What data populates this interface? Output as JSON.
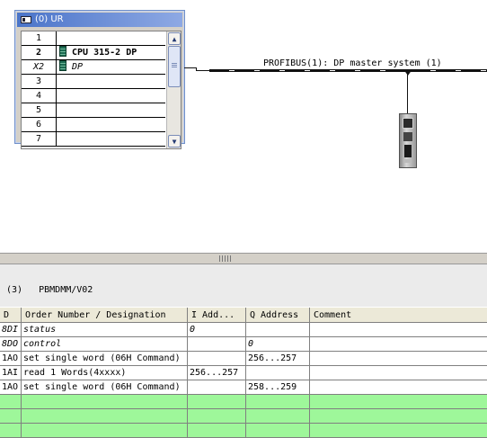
{
  "rack": {
    "title": "(0) UR",
    "slots": [
      {
        "num": "1",
        "module": ""
      },
      {
        "num": "2",
        "module": "CPU 315-2 DP"
      },
      {
        "num": "X2",
        "module": "DP"
      },
      {
        "num": "3",
        "module": ""
      },
      {
        "num": "4",
        "module": ""
      },
      {
        "num": "5",
        "module": ""
      },
      {
        "num": "6",
        "module": ""
      },
      {
        "num": "7",
        "module": ""
      }
    ]
  },
  "bus": {
    "label": "PROFIBUS(1): DP master system (1)"
  },
  "detail": {
    "header": "(3)   PBMDMM/V02",
    "columns": [
      "D",
      "Order Number / Designation",
      "I Add...",
      "Q Address",
      "Comment"
    ],
    "rows": [
      {
        "slot": "8DI",
        "designation": "status",
        "i_addr": "0",
        "q_addr": "",
        "comment": ""
      },
      {
        "slot": "8DO",
        "designation": "control",
        "i_addr": "",
        "q_addr": "0",
        "comment": ""
      },
      {
        "slot": "1AO",
        "designation": "set single word (06H Command)",
        "i_addr": "",
        "q_addr": "256...257",
        "comment": ""
      },
      {
        "slot": "1AI",
        "designation": "read 1 Words(4xxxx)",
        "i_addr": "256...257",
        "q_addr": "",
        "comment": ""
      },
      {
        "slot": "1AO",
        "designation": "set single word (06H Command)",
        "i_addr": "",
        "q_addr": "258...259",
        "comment": ""
      }
    ],
    "empty_row_color": "#9ef79a"
  }
}
